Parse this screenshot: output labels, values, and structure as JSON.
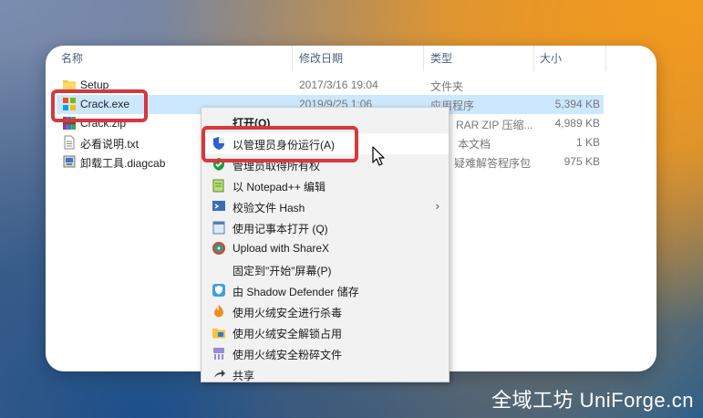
{
  "columns": {
    "name": "名称",
    "date": "修改日期",
    "type": "类型",
    "size": "大小"
  },
  "files": [
    {
      "name": "Setup",
      "date": "2017/3/16 19:04",
      "type": "文件夹",
      "size": "",
      "icon": "folder-icon"
    },
    {
      "name": "Crack.exe",
      "date": "2019/9/25 1:06",
      "type": "应用程序",
      "size": "5,394 KB",
      "icon": "exe-icon"
    },
    {
      "name": "Crack.zip",
      "date": "",
      "type": "RAR ZIP 压缩...",
      "size": "4,989 KB",
      "icon": "zip-icon"
    },
    {
      "name": "必看说明.txt",
      "date": "",
      "type": "本文档",
      "size": "1 KB",
      "icon": "txt-icon"
    },
    {
      "name": "卸载工具.diagcab",
      "date": "",
      "type": "疑难解答程序包",
      "size": "975 KB",
      "icon": "diagcab-icon"
    }
  ],
  "menu": [
    {
      "label": "打开(O)",
      "icon": ""
    },
    {
      "label": "以管理员身份运行(A)",
      "icon": "uac-shield-icon"
    },
    {
      "label": "管理员取得所有权",
      "icon": "green-shield-icon"
    },
    {
      "label": "以 Notepad++ 编辑",
      "icon": "notepadpp-icon"
    },
    {
      "label": "校验文件 Hash",
      "icon": "hash-icon"
    },
    {
      "label": "使用记事本打开 (Q)",
      "icon": "notepad-icon"
    },
    {
      "label": "Upload with ShareX",
      "icon": "sharex-icon"
    },
    {
      "label": "固定到\"开始\"屏幕(P)",
      "icon": ""
    },
    {
      "label": "由 Shadow Defender 储存",
      "icon": "shadow-defender-icon"
    },
    {
      "label": "使用火绒安全进行杀毒",
      "icon": "huorong-flame-icon"
    },
    {
      "label": "使用火绒安全解锁占用",
      "icon": "huorong-unlock-icon"
    },
    {
      "label": "使用火绒安全粉碎文件",
      "icon": "huorong-shred-icon"
    },
    {
      "label": "共享",
      "icon": "share-icon"
    }
  ],
  "watermark": "全域工坊 UniForge.cn",
  "colors": {
    "selection": "#cce8ff",
    "highlight_box": "#d9363e",
    "menu_bg": "#f2f2f2"
  }
}
